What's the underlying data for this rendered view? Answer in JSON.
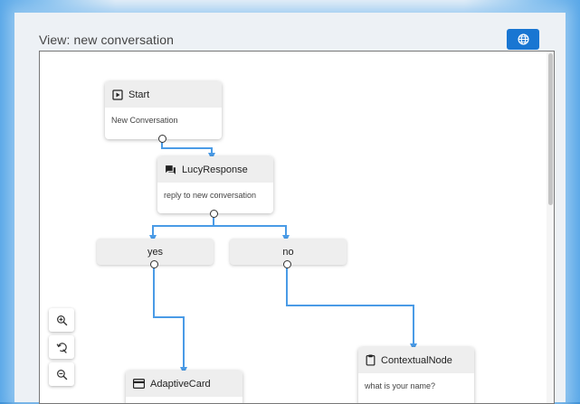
{
  "header": {
    "title": "View: new conversation",
    "globe_icon": "globe-icon",
    "accent": "#1976d2"
  },
  "flow": {
    "edge_color": "#4a9be6",
    "nodes": {
      "start": {
        "title": "Start",
        "body": "New Conversation",
        "icon": "play-box-icon"
      },
      "lucy": {
        "title": "LucyResponse",
        "body": "reply to new conversation",
        "icon": "chat-icon"
      },
      "yes": {
        "label": "yes"
      },
      "no": {
        "label": "no"
      },
      "adaptive": {
        "title": "AdaptiveCard",
        "icon": "card-icon"
      },
      "contextual": {
        "title": "ContextualNode",
        "body": "what is your name?",
        "icon": "clipboard-icon"
      }
    }
  },
  "zoom_controls": [
    "zoom-in-icon",
    "reset-zoom-icon",
    "zoom-out-icon"
  ]
}
